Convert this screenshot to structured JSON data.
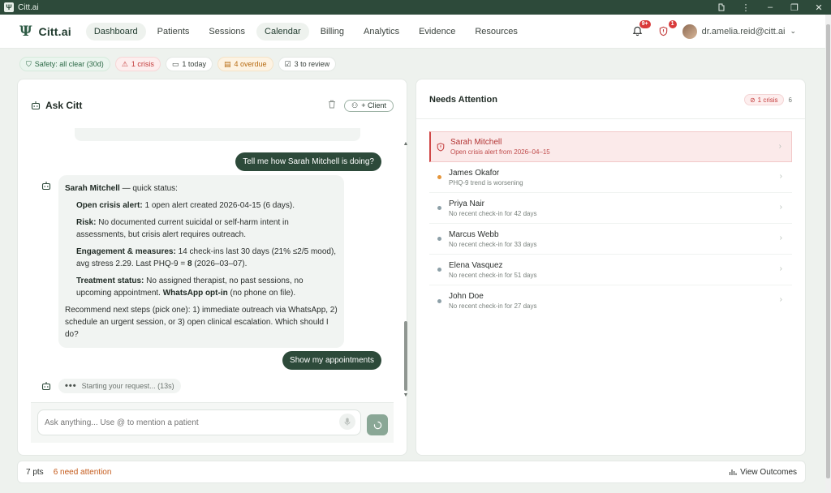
{
  "window": {
    "title": "Citt.ai"
  },
  "nav": {
    "brand": "Citt.ai",
    "links": [
      {
        "label": "Dashboard",
        "active": true
      },
      {
        "label": "Patients"
      },
      {
        "label": "Sessions"
      },
      {
        "label": "Calendar",
        "active": true
      },
      {
        "label": "Billing"
      },
      {
        "label": "Analytics"
      },
      {
        "label": "Evidence"
      },
      {
        "label": "Resources"
      }
    ],
    "notifications_badge": "9+",
    "alerts_badge": "1",
    "user_email": "dr.amelia.reid@citt.ai"
  },
  "status_chips": {
    "safety": "Safety: all clear (30d)",
    "crisis": "1 crisis",
    "today": "1 today",
    "overdue": "4 overdue",
    "review": "3 to review"
  },
  "ask": {
    "title": "Ask Citt",
    "client_button": "+ Client",
    "messages": {
      "user1": "Tell me how Sarah Mitchell is doing?",
      "bot_intro_name": "Sarah Mitchell",
      "bot_intro_rest": " — quick status:",
      "crisis_label": "Open crisis alert:",
      "crisis_text": " 1 open alert created 2026-04-15 (6 days).",
      "risk_label": "Risk:",
      "risk_text": " No documented current suicidal or self-harm intent in assessments, but crisis alert requires outreach.",
      "engagement_label": "Engagement & measures:",
      "engagement_text_a": " 14 check-ins last 30 days (21% ≤2/5 mood), avg stress 2.29. Last PHQ-9 = ",
      "engagement_value": "8",
      "engagement_text_b": " (2026–03–07).",
      "treatment_label": "Treatment status:",
      "treatment_text": " No assigned therapist, no past sessions, no upcoming appointment. ",
      "whatsapp_label": "WhatsApp opt-in",
      "whatsapp_text": " (no phone on file).",
      "recommend": "Recommend next steps (pick one): 1) immediate outreach via WhatsApp, 2) schedule an urgent session, or 3) open clinical escalation. Which should I do?",
      "user2": "Show my appointments",
      "typing": "Starting your request... (13s)"
    },
    "input_placeholder": "Ask anything... Use @ to mention a patient"
  },
  "attention": {
    "title": "Needs Attention",
    "crisis_badge": "1 crisis",
    "count": "6",
    "items": [
      {
        "name": "Sarah Mitchell",
        "sub": "Open crisis alert from 2026–04–15"
      },
      {
        "name": "James Okafor",
        "sub": "PHQ-9 trend is worsening"
      },
      {
        "name": "Priya Nair",
        "sub": "No recent check-in for 42 days"
      },
      {
        "name": "Marcus Webb",
        "sub": "No recent check-in for 33 days"
      },
      {
        "name": "Elena Vasquez",
        "sub": "No recent check-in for 51 days"
      },
      {
        "name": "John Doe",
        "sub": "No recent check-in for 27 days"
      }
    ]
  },
  "footer": {
    "pts": "7 pts",
    "need": "6 need attention",
    "outcomes": "View Outcomes"
  }
}
